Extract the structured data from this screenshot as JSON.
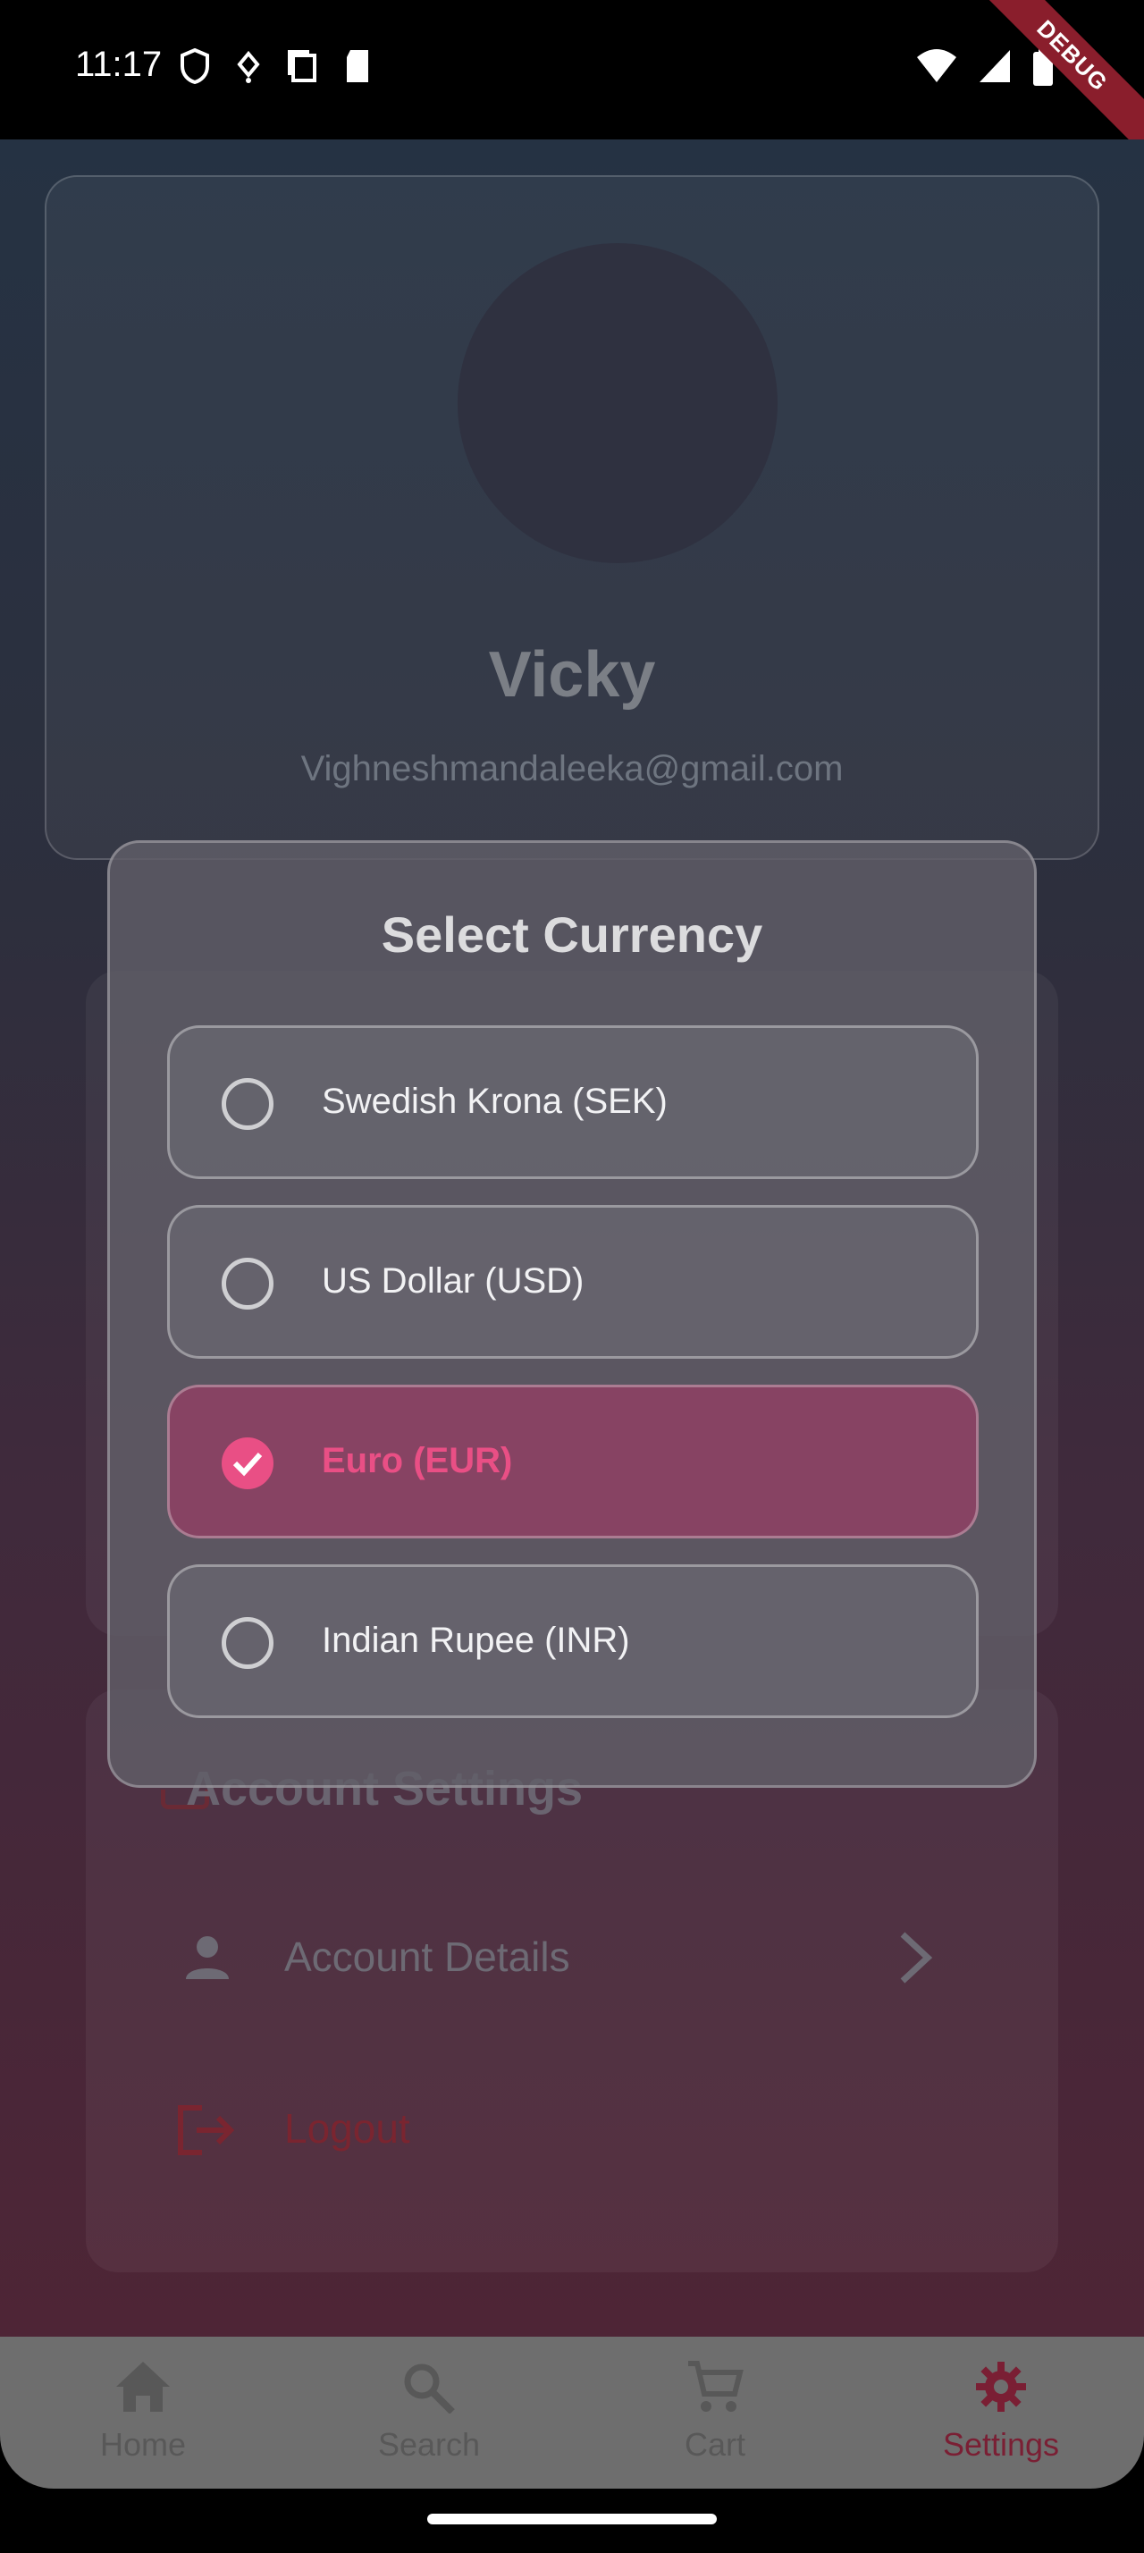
{
  "status_bar": {
    "time": "11:17",
    "debug_label": "DEBUG"
  },
  "profile": {
    "name": "Vicky",
    "email": "Vighneshmandaleeka@gmail.com"
  },
  "account_section": {
    "title": "Account Settings",
    "details_label": "Account Details",
    "logout_label": "Logout"
  },
  "dialog": {
    "title": "Select Currency",
    "options": [
      {
        "label": "Swedish Krona (SEK)",
        "selected": false
      },
      {
        "label": "US Dollar (USD)",
        "selected": false
      },
      {
        "label": "Euro (EUR)",
        "selected": true
      },
      {
        "label": "Indian Rupee (INR)",
        "selected": false
      }
    ]
  },
  "bottom_nav": {
    "items": [
      {
        "label": "Home",
        "icon": "home-icon",
        "active": false
      },
      {
        "label": "Search",
        "icon": "search-icon",
        "active": false
      },
      {
        "label": "Cart",
        "icon": "cart-icon",
        "active": false
      },
      {
        "label": "Settings",
        "icon": "settings-icon",
        "active": true
      }
    ]
  },
  "colors": {
    "accent": "#e94f85",
    "nav_active": "#7a1f34",
    "logout": "#7a2530"
  }
}
